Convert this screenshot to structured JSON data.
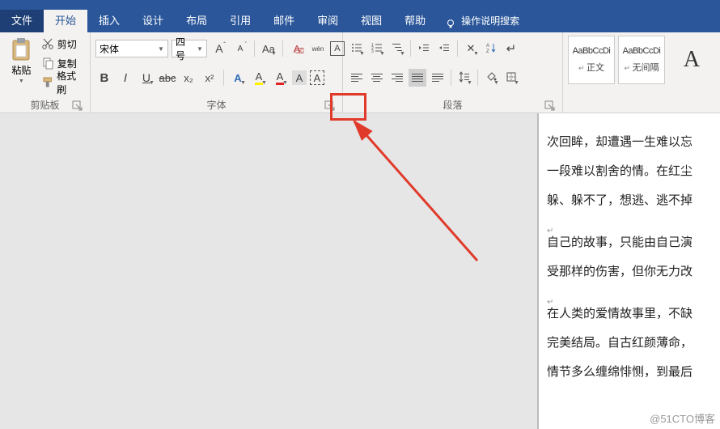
{
  "tabs": {
    "file": "文件",
    "home": "开始",
    "insert": "插入",
    "design": "设计",
    "layout": "布局",
    "references": "引用",
    "mailings": "邮件",
    "review": "审阅",
    "view": "视图",
    "help": "帮助"
  },
  "search_hint": "操作说明搜索",
  "clipboard": {
    "paste": "粘贴",
    "cut": "剪切",
    "copy": "复制",
    "format_painter": "格式刷",
    "group_label": "剪贴板"
  },
  "font": {
    "name": "宋体",
    "size": "四号",
    "group_label": "字体",
    "btn_bold": "B",
    "btn_italic": "I",
    "btn_underline": "U",
    "btn_strike": "abc",
    "btn_sub": "x₂",
    "btn_sup": "x²",
    "btn_grow": "A",
    "btn_shrink": "A",
    "btn_changecase": "Aa",
    "btn_clear": "A",
    "btn_phonetic": "wén",
    "btn_enclose": "A",
    "btn_text_effect": "A",
    "btn_highlight": "A",
    "btn_fontcolor": "A",
    "btn_charshade": "A",
    "btn_charborder": "A"
  },
  "paragraph": {
    "group_label": "段落"
  },
  "styles": {
    "sample": "AaBbCcDi",
    "normal": "正文",
    "nospace": "无间隔"
  },
  "document": {
    "lines": [
      "次回眸，却遭遇一生难以忘",
      "一段难以割舍的情。在红尘",
      "躲、躲不了，想逃、逃不掉"
    ],
    "sel_lines": [
      "自己的故事，只能由自己演",
      "受那样的伤害，但你无力改"
    ],
    "lines2": [
      "在人类的爱情故事里，不缺",
      "完美结局。自古红颜薄命，",
      "情节多么缠绵悱恻，到最后"
    ]
  },
  "watermark": "@51CTO博客"
}
